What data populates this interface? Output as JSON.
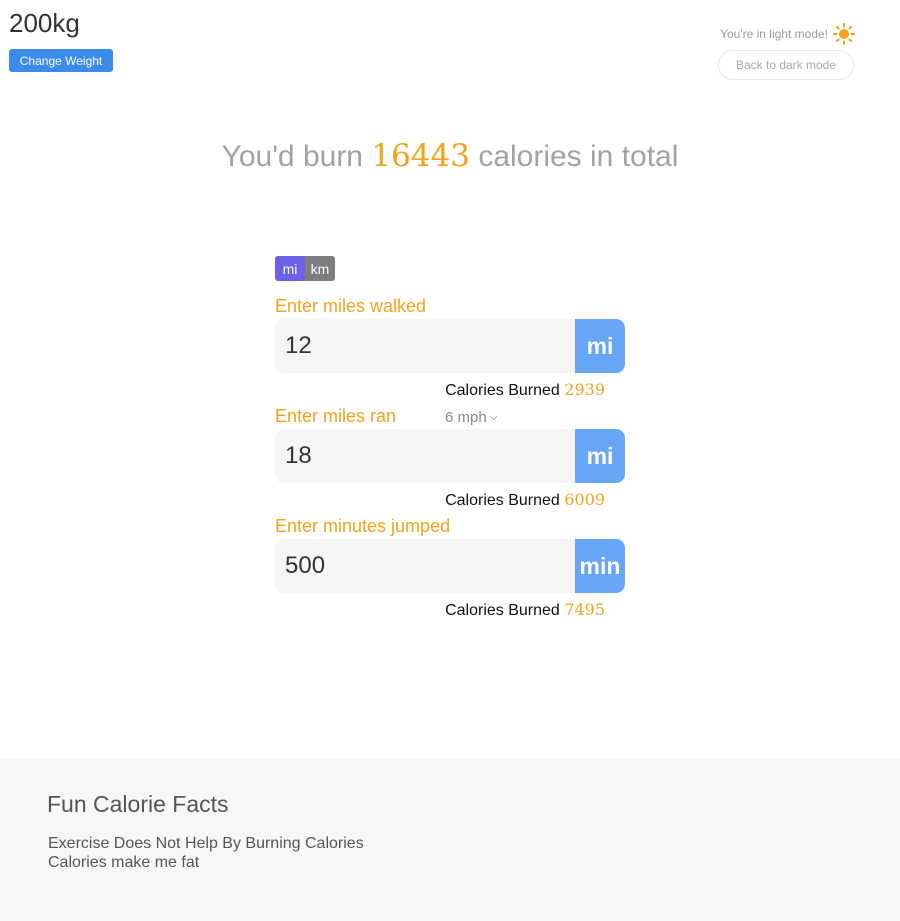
{
  "header": {
    "weight": "200kg",
    "change_weight_label": "Change Weight",
    "mode_text": "You're in light mode!",
    "dark_mode_label": "Back to dark mode",
    "mode_icon": "sun-icon"
  },
  "summary": {
    "prefix": "You'd burn",
    "total": "16443",
    "suffix": "calories in total"
  },
  "units": {
    "options": [
      "mi",
      "km"
    ],
    "selected": "mi"
  },
  "activities": [
    {
      "label": "Enter miles walked",
      "value": "12",
      "unit": "mi",
      "burned_label": "Calories Burned",
      "burned_value": "2939"
    },
    {
      "label": "Enter miles ran",
      "value": "18",
      "unit": "mi",
      "speed": "6 mph",
      "burned_label": "Calories Burned",
      "burned_value": "6009"
    },
    {
      "label": "Enter minutes jumped",
      "value": "500",
      "unit": "min",
      "burned_label": "Calories Burned",
      "burned_value": "7495"
    }
  ],
  "footer": {
    "title": "Fun Calorie Facts",
    "facts": [
      "Exercise Does Not Help By Burning Calories",
      "Calories make me fat"
    ]
  },
  "colors": {
    "accent": "#f7a11a",
    "primary_button": "#3b8beb",
    "unit_suffix": "#67a6f5",
    "toggle_selected": "#6b62e8",
    "toggle_unselected": "#7d7d7d"
  }
}
